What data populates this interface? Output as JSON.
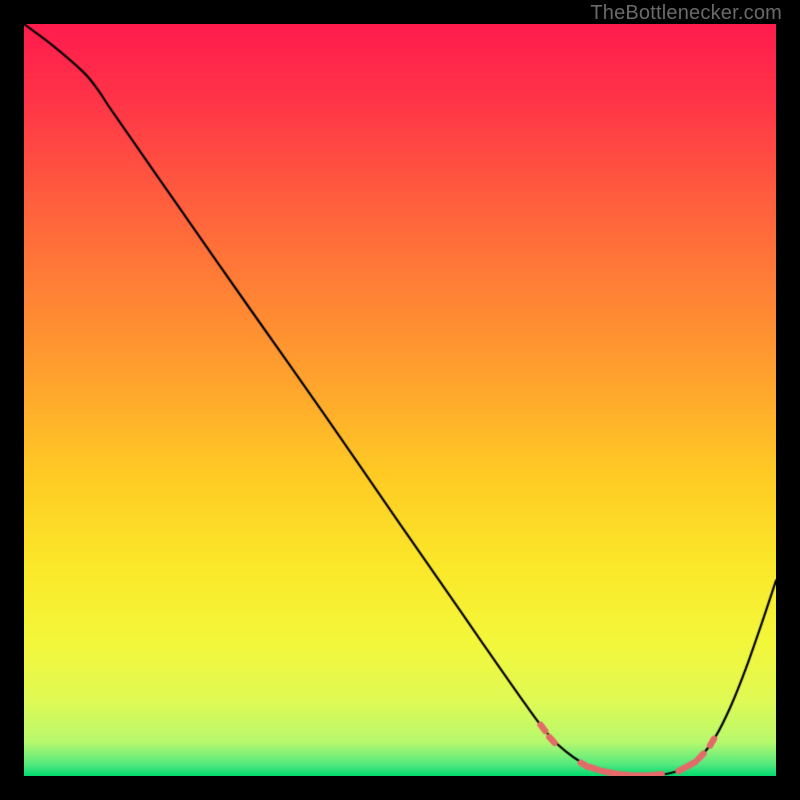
{
  "attribution": "TheBottlenecker.com",
  "chart_data": {
    "type": "line",
    "title": "",
    "xlabel": "",
    "ylabel": "",
    "xlim": [
      0,
      100
    ],
    "ylim": [
      0,
      100
    ],
    "curve_x": [
      0,
      4,
      8,
      10,
      12,
      20,
      30,
      40,
      50,
      58,
      62,
      66,
      68,
      70,
      72,
      74,
      76,
      78,
      80,
      82,
      84,
      86,
      88,
      90,
      92,
      94,
      96,
      98,
      100
    ],
    "curve_y": [
      100,
      97,
      93.5,
      91,
      88,
      76.5,
      62.2,
      48,
      33.5,
      22,
      16.2,
      10.5,
      7.7,
      5.2,
      3.3,
      1.9,
      1.0,
      0.45,
      0.15,
      0.05,
      0.1,
      0.4,
      1.1,
      2.6,
      5.3,
      9.3,
      14.3,
      20.0,
      26.0
    ],
    "markers": [
      {
        "x": 69.0,
        "y": 6.4
      },
      {
        "x": 70.2,
        "y": 4.8
      },
      {
        "x": 74.5,
        "y": 1.5
      },
      {
        "x": 75.8,
        "y": 1.0
      },
      {
        "x": 77.2,
        "y": 0.6
      },
      {
        "x": 78.5,
        "y": 0.35
      },
      {
        "x": 80.0,
        "y": 0.15
      },
      {
        "x": 81.5,
        "y": 0.08
      },
      {
        "x": 83.0,
        "y": 0.08
      },
      {
        "x": 84.3,
        "y": 0.18
      },
      {
        "x": 87.5,
        "y": 0.9
      },
      {
        "x": 88.8,
        "y": 1.6
      },
      {
        "x": 90.0,
        "y": 2.6
      },
      {
        "x": 91.5,
        "y": 4.5
      }
    ],
    "gradient_stops": [
      {
        "pos": 0.0,
        "color": "#ff1c4e"
      },
      {
        "pos": 0.1,
        "color": "#ff3448"
      },
      {
        "pos": 0.22,
        "color": "#ff5a3f"
      },
      {
        "pos": 0.35,
        "color": "#ff8036"
      },
      {
        "pos": 0.48,
        "color": "#ffa52d"
      },
      {
        "pos": 0.6,
        "color": "#ffcb24"
      },
      {
        "pos": 0.72,
        "color": "#fbe82a"
      },
      {
        "pos": 0.82,
        "color": "#f4f73a"
      },
      {
        "pos": 0.9,
        "color": "#e0fa55"
      },
      {
        "pos": 0.955,
        "color": "#b7f96e"
      },
      {
        "pos": 0.985,
        "color": "#52e97e"
      },
      {
        "pos": 1.0,
        "color": "#00da6f"
      }
    ],
    "curve_color": "#000000",
    "marker_color": "#e46a6a"
  }
}
